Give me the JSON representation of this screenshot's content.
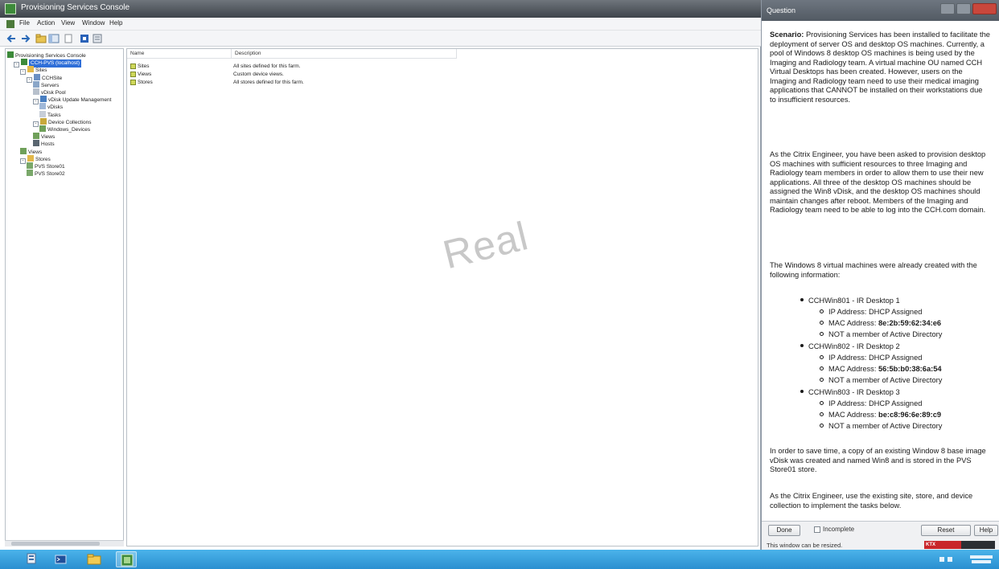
{
  "console": {
    "title": "Provisioning Services Console",
    "menu": [
      "File",
      "Action",
      "View",
      "Window",
      "Help"
    ],
    "tree": [
      {
        "label": "Provisioning Services Console",
        "indent": 0,
        "icon": "console-icon",
        "expander": ""
      },
      {
        "label": "CCH-PVS (localhost)",
        "indent": 1,
        "icon": "server-icon",
        "expander": "-",
        "selected": true
      },
      {
        "label": "Sites",
        "indent": 2,
        "icon": "folder-icon",
        "expander": "-"
      },
      {
        "label": "CCHSite",
        "indent": 3,
        "icon": "site-icon",
        "expander": "-"
      },
      {
        "label": "Servers",
        "indent": 4,
        "icon": "servers-icon",
        "expander": ""
      },
      {
        "label": "vDisk Pool",
        "indent": 4,
        "icon": "vdisk-pool-icon",
        "expander": ""
      },
      {
        "label": "vDisk Update Management",
        "indent": 4,
        "icon": "update-icon",
        "expander": "-"
      },
      {
        "label": "vDisks",
        "indent": 5,
        "icon": "vdisk-icon",
        "expander": ""
      },
      {
        "label": "Tasks",
        "indent": 5,
        "icon": "tasks-icon",
        "expander": ""
      },
      {
        "label": "Device Collections",
        "indent": 4,
        "icon": "collection-icon",
        "expander": "-"
      },
      {
        "label": "Windows_Devices",
        "indent": 5,
        "icon": "device-icon",
        "expander": ""
      },
      {
        "label": "Views",
        "indent": 4,
        "icon": "views-icon",
        "expander": ""
      },
      {
        "label": "Hosts",
        "indent": 4,
        "icon": "hosts-icon",
        "expander": ""
      },
      {
        "label": "Views",
        "indent": 2,
        "icon": "views-icon",
        "expander": ""
      },
      {
        "label": "Stores",
        "indent": 2,
        "icon": "stores-icon",
        "expander": "-"
      },
      {
        "label": "PVS Store01",
        "indent": 3,
        "icon": "store-icon",
        "expander": ""
      },
      {
        "label": "PVS Store02",
        "indent": 3,
        "icon": "store-icon",
        "expander": ""
      }
    ],
    "list": {
      "columns": [
        "Name",
        "Description"
      ],
      "rows": [
        {
          "name": "Sites",
          "description": "All sites defined for this farm."
        },
        {
          "name": "Views",
          "description": "Custom device views."
        },
        {
          "name": "Stores",
          "description": "All stores defined for this farm."
        }
      ]
    },
    "watermark": "Real"
  },
  "question": {
    "title": "Question",
    "scenario_label": "Scenario:",
    "p1": "Provisioning Services has been installed to facilitate the deployment of server OS and desktop OS machines. Currently, a pool of Windows 8 desktop OS machines is being used by the Imaging and Radiology team. A virtual machine OU named CCH Virtual Desktops has been created. However, users on the Imaging and Radiology team need to use their medical imaging applications that CANNOT be installed on their workstations due to insufficient resources.",
    "p2": "As the Citrix Engineer, you have been asked to provision desktop OS machines with sufficient resources to three Imaging and Radiology team members in order to allow them to use their new applications. All three of the desktop OS machines should be assigned the Win8 vDisk, and the desktop OS machines should maintain changes after reboot. Members of the Imaging and Radiology team need to be able to log into the CCH.com domain.",
    "p3": "The Windows 8 virtual machines were already created with the following information:",
    "machines": [
      {
        "name": "CCHWin801 - IR Desktop 1",
        "ip": "IP Address: DHCP Assigned",
        "mac_label": "MAC Address: ",
        "mac": "8e:2b:59:62:34:e6",
        "ad": "NOT a member of Active Directory"
      },
      {
        "name": "CCHWin802 - IR Desktop 2",
        "ip": "IP Address: DHCP Assigned",
        "mac_label": "MAC Address: ",
        "mac": "56:5b:b0:38:6a:54",
        "ad": "NOT a member of Active Directory"
      },
      {
        "name": "CCHWin803 - IR Desktop 3",
        "ip": "IP Address: DHCP Assigned",
        "mac_label": "MAC Address: ",
        "mac": "be:c8:96:6e:89:c9",
        "ad": "NOT a member of Active Directory"
      }
    ],
    "p4": "In order to save time, a copy of an existing Window 8 base image vDisk was created and named Win8 and is stored in the PVS Store01 store.",
    "p5": "As the Citrix Engineer, use the existing site, store, and device collection to implement the tasks below.",
    "footer": {
      "done": "Done",
      "incomplete": "Incomplete",
      "reset": "Reset",
      "help": "Help",
      "resize_note": "This window can be resized.",
      "brand": "KTX Simulation"
    }
  },
  "taskbar": {
    "items": [
      "server-manager-icon",
      "powershell-icon",
      "file-explorer-icon",
      "provisioning-console-icon"
    ]
  }
}
